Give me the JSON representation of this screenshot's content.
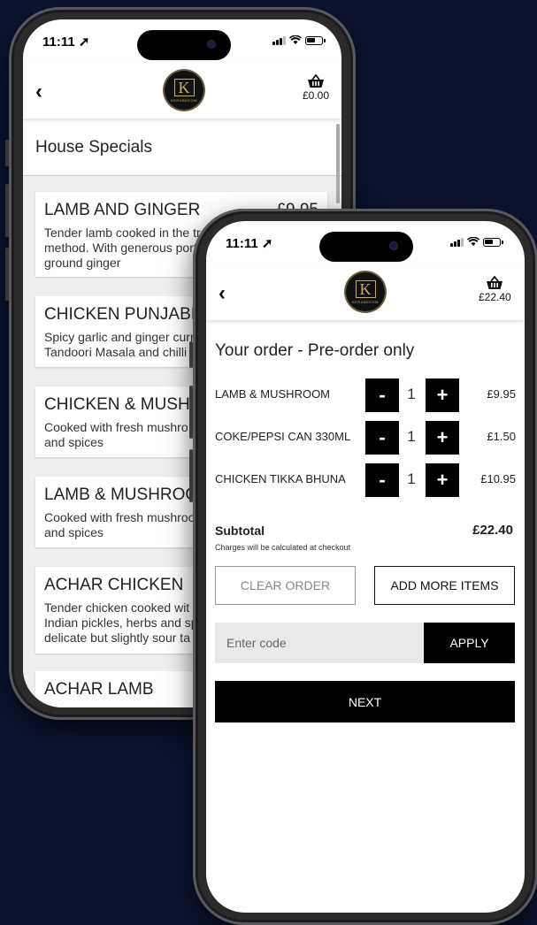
{
  "back_phone": {
    "status_time": "11:11",
    "basket_total": "£0.00",
    "section_title": "House Specials",
    "menu_items": [
      {
        "name": "LAMB AND GINGER",
        "price": "£9.95",
        "desc": "Tender lamb cooked in the tra method. With generous port ground ginger"
      },
      {
        "name": "CHICKEN PUNJABI",
        "price": "",
        "desc": "Spicy garlic and ginger curr Tandoori Masala and chilli"
      },
      {
        "name": "CHICKEN & MUSHR",
        "price": "",
        "desc": "Cooked with fresh mushro and spices"
      },
      {
        "name": "LAMB & MUSHROO",
        "price": "",
        "desc": "Cooked with fresh mushroo and spices"
      },
      {
        "name": "ACHAR CHICKEN",
        "price": "",
        "desc": "Tender chicken cooked wit Indian pickles, herbs and sp delicate but slightly sour ta"
      },
      {
        "name": "ACHAR LAMB",
        "price": "",
        "desc": ""
      }
    ]
  },
  "front_phone": {
    "status_time": "11:11",
    "basket_total": "£22.40",
    "order_title": "Your order - Pre-order only",
    "order_items": [
      {
        "name": "LAMB & MUSHROOM",
        "qty": "1",
        "price": "£9.95"
      },
      {
        "name": "COKE/PEPSI CAN 330ML",
        "qty": "1",
        "price": "£1.50"
      },
      {
        "name": "CHICKEN TIKKA BHUNA",
        "qty": "1",
        "price": "£10.95"
      }
    ],
    "minus_label": "-",
    "plus_label": "+",
    "subtotal_label": "Subtotal",
    "subtotal_value": "£22.40",
    "charges_note": "Charges will be calculated at checkout",
    "clear_order_label": "CLEAR ORDER",
    "add_more_label": "ADD MORE ITEMS",
    "code_placeholder": "Enter code",
    "apply_label": "APPLY",
    "next_label": "NEXT"
  },
  "logo": {
    "letter": "K",
    "word": "KERABEEGM"
  },
  "colors": {
    "background": "#0b1530",
    "button_dark": "#000000",
    "gold": "#c9a96e"
  }
}
